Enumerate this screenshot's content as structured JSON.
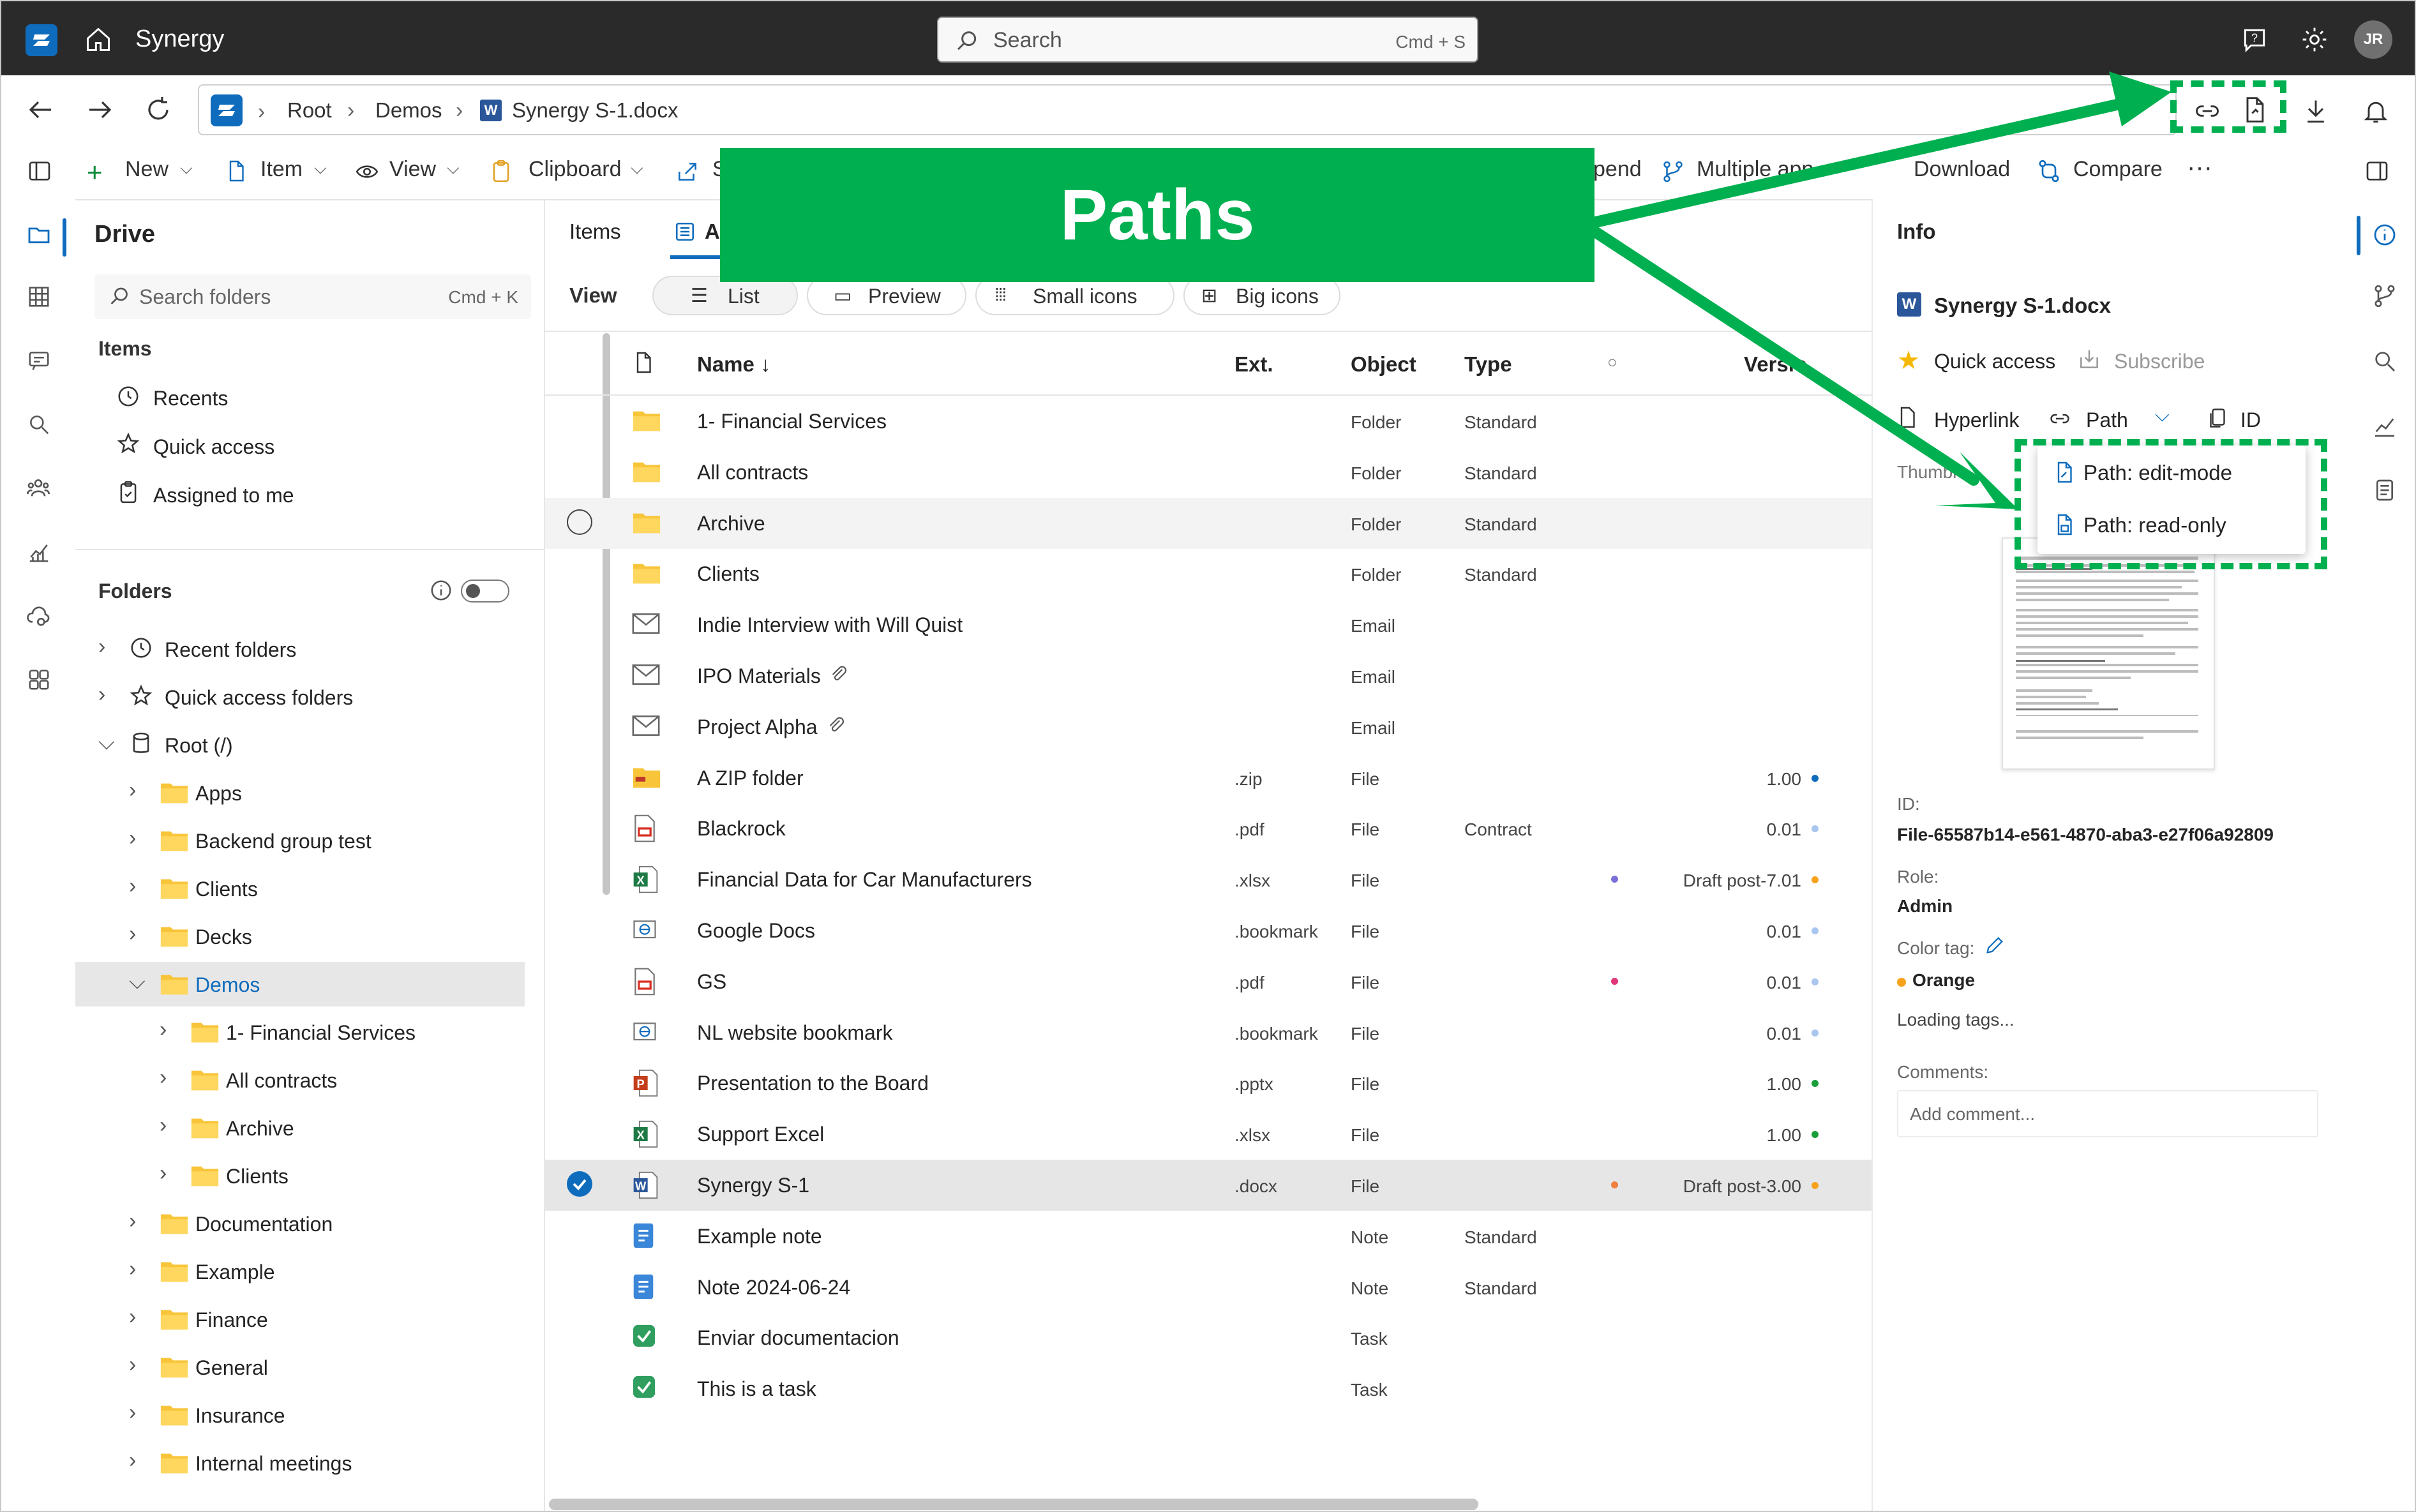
{
  "app": {
    "name": "Synergy"
  },
  "search": {
    "placeholder": "Search",
    "shortcut": "Cmd + S"
  },
  "user": {
    "initials": "JR"
  },
  "breadcrumb": {
    "items": [
      "Root",
      "Demos",
      "Synergy S-1.docx"
    ]
  },
  "toolbar": {
    "items": [
      "New",
      "Item",
      "View",
      "Clipboard",
      "S",
      "pend",
      "Multiple app",
      "Download",
      "Compare"
    ],
    "more": "···"
  },
  "overlay": {
    "banner": "Paths"
  },
  "sidebar": {
    "title": "Drive",
    "search_placeholder": "Search folders",
    "search_shortcut": "Cmd + K",
    "items_heading": "Items",
    "items": [
      "Recents",
      "Quick access",
      "Assigned to me"
    ],
    "folders_heading": "Folders",
    "tree": [
      {
        "label": "Recent folders"
      },
      {
        "label": "Quick access folders"
      },
      {
        "label": "Root (/)"
      },
      {
        "label": "Apps"
      },
      {
        "label": "Backend group test"
      },
      {
        "label": "Clients"
      },
      {
        "label": "Decks"
      },
      {
        "label": "Demos"
      },
      {
        "label": "1- Financial Services"
      },
      {
        "label": "All contracts"
      },
      {
        "label": "Archive"
      },
      {
        "label": "Clients"
      },
      {
        "label": "Documentation"
      },
      {
        "label": "Example"
      },
      {
        "label": "Finance"
      },
      {
        "label": "General"
      },
      {
        "label": "Insurance"
      },
      {
        "label": "Internal meetings"
      }
    ]
  },
  "main": {
    "tabs": [
      "Items",
      "A"
    ],
    "view_label": "View",
    "view_options": [
      "List",
      "Preview",
      "Small icons",
      "Big icons"
    ],
    "columns": {
      "name": "Name ↓",
      "ext": "Ext.",
      "object": "Object",
      "type": "Type",
      "tag": "○",
      "version": "Versio"
    },
    "rows": [
      {
        "name": "1- Financial Services",
        "ext": "",
        "object": "Folder",
        "type": "Standard",
        "version": "",
        "icon": "folder"
      },
      {
        "name": "All contracts",
        "ext": "",
        "object": "Folder",
        "type": "Standard",
        "version": "",
        "icon": "folder"
      },
      {
        "name": "Archive",
        "ext": "",
        "object": "Folder",
        "type": "Standard",
        "version": "",
        "icon": "folder"
      },
      {
        "name": "Clients",
        "ext": "",
        "object": "Folder",
        "type": "Standard",
        "version": "",
        "icon": "folder"
      },
      {
        "name": "Indie Interview with Will Quist",
        "ext": "",
        "object": "Email",
        "type": "",
        "version": "",
        "icon": "email"
      },
      {
        "name": "IPO Materials",
        "ext": "",
        "object": "Email",
        "type": "",
        "version": "",
        "icon": "email"
      },
      {
        "name": "Project Alpha",
        "ext": "",
        "object": "Email",
        "type": "",
        "version": "",
        "icon": "email"
      },
      {
        "name": "A ZIP folder",
        "ext": ".zip",
        "object": "File",
        "type": "",
        "version": "1.00",
        "icon": "zip"
      },
      {
        "name": "Blackrock",
        "ext": ".pdf",
        "object": "File",
        "type": "Contract",
        "version": "0.01",
        "icon": "pdf"
      },
      {
        "name": "Financial Data for Car Manufacturers",
        "ext": ".xlsx",
        "object": "File",
        "type": "",
        "version": "Draft post-7.01",
        "icon": "excel"
      },
      {
        "name": "Google Docs",
        "ext": ".bookmark",
        "object": "File",
        "type": "",
        "version": "0.01",
        "icon": "bookmark"
      },
      {
        "name": "GS",
        "ext": ".pdf",
        "object": "File",
        "type": "",
        "version": "0.01",
        "icon": "pdf"
      },
      {
        "name": "NL website bookmark",
        "ext": ".bookmark",
        "object": "File",
        "type": "",
        "version": "0.01",
        "icon": "bookmark"
      },
      {
        "name": "Presentation to the Board",
        "ext": ".pptx",
        "object": "File",
        "type": "",
        "version": "1.00",
        "icon": "ppt"
      },
      {
        "name": "Support Excel",
        "ext": ".xlsx",
        "object": "File",
        "type": "",
        "version": "1.00",
        "icon": "excel"
      },
      {
        "name": "Synergy S-1",
        "ext": ".docx",
        "object": "File",
        "type": "",
        "version": "Draft post-3.00",
        "icon": "word"
      },
      {
        "name": "Example note",
        "ext": "",
        "object": "Note",
        "type": "Standard",
        "version": "",
        "icon": "note"
      },
      {
        "name": "Note 2024-06-24",
        "ext": "",
        "object": "Note",
        "type": "Standard",
        "version": "",
        "icon": "note"
      },
      {
        "name": "Enviar documentacion",
        "ext": "",
        "object": "Task",
        "type": "",
        "version": "",
        "icon": "task"
      },
      {
        "name": "This is a task",
        "ext": "",
        "object": "Task",
        "type": "",
        "version": "",
        "icon": "task"
      }
    ]
  },
  "info": {
    "title": "Info",
    "filename": "Synergy S-1.docx",
    "quick_access": "Quick access",
    "subscribe": "Subscribe",
    "hyperlink": "Hyperlink",
    "path": "Path",
    "id_btn": "ID",
    "thumbnail_label": "Thumbn",
    "id_label": "ID:",
    "id_value": "File-65587b14-e561-4870-aba3-e27f06a92809",
    "role_label": "Role:",
    "role_value": "Admin",
    "color_label": "Color tag:",
    "color_value": "Orange",
    "loading_tags": "Loading tags...",
    "comments_label": "Comments:",
    "comment_placeholder": "Add comment..."
  },
  "path_menu": {
    "items": [
      "Path: edit-mode",
      "Path: read-only"
    ]
  },
  "colors": {
    "accent": "#0f6cbd",
    "overlay_green": "#00b050",
    "orange": "#f7a21b",
    "titlebar": "#2a2a2a"
  }
}
